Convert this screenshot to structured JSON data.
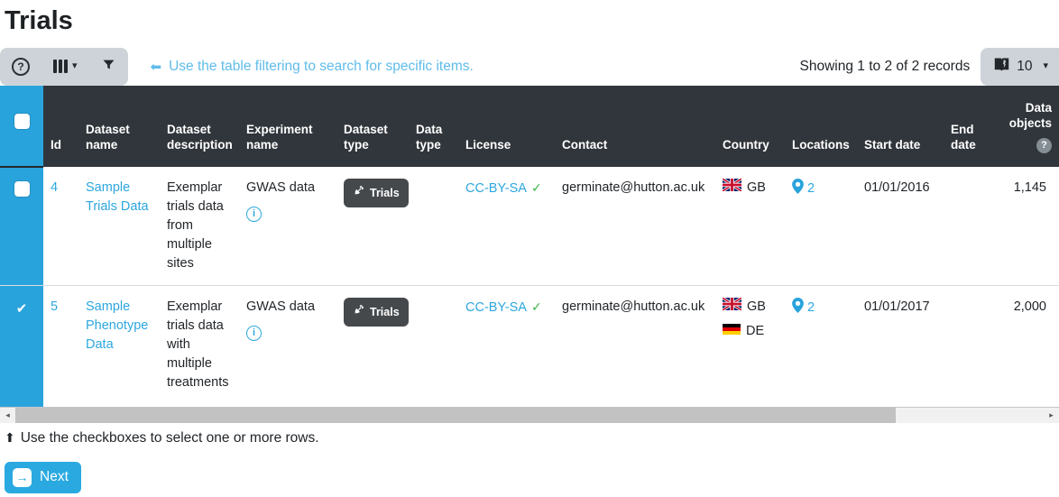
{
  "page": {
    "title": "Trials"
  },
  "toolbar": {
    "help_icon": "?",
    "columns_caret": "▾",
    "hint_arrow": "⬅",
    "hint": "Use the table filtering to search for specific items.",
    "showing": "Showing 1 to 2 of 2 records",
    "page_size": "10",
    "page_size_caret": "▾"
  },
  "table": {
    "headers": [
      "Id",
      "Dataset name",
      "Dataset description",
      "Experiment name",
      "Dataset type",
      "Data type",
      "License",
      "Contact",
      "Country",
      "Locations",
      "Start date",
      "End date",
      "Data objects"
    ],
    "data_objects_help_icon": "?",
    "rows": [
      {
        "id": "4",
        "dataset_name": "Sample Trials Data",
        "dataset_description": "Exemplar trials data from multiple sites",
        "experiment_name": "GWAS data",
        "dataset_type": "Trials",
        "data_type": "",
        "license": "CC-BY-SA",
        "contact": "germinate@hutton.ac.uk",
        "countries": [
          {
            "code": "GB"
          }
        ],
        "locations": "2",
        "start_date": "01/01/2016",
        "end_date": "",
        "data_objects": "1,145",
        "selected": false
      },
      {
        "id": "5",
        "dataset_name": "Sample Phenotype Data",
        "dataset_description": "Exemplar trials data with multiple treatments",
        "experiment_name": "GWAS data",
        "dataset_type": "Trials",
        "data_type": "",
        "license": "CC-BY-SA",
        "contact": "germinate@hutton.ac.uk",
        "countries": [
          {
            "code": "GB"
          },
          {
            "code": "DE"
          }
        ],
        "locations": "2",
        "start_date": "01/01/2017",
        "end_date": "",
        "data_objects": "2,000",
        "selected": true
      }
    ]
  },
  "icons": {
    "check_mark": "✔",
    "green_check": "✓",
    "info": "i",
    "up_arrow": "⬆",
    "next_arrow": "→",
    "scroll_left": "◂",
    "scroll_right": "▸"
  },
  "footer": {
    "hint": "Use the checkboxes to select one or more rows.",
    "next_label": "Next"
  },
  "colors": {
    "accent_blue": "#29a3dc",
    "header_dark": "#31363c",
    "link_blue": "#2da7de",
    "green_check": "#3cb54a",
    "badge_dark": "#46494c",
    "toolbar_gray": "#cdd3d9",
    "hint_blue": "#5fbce9"
  }
}
